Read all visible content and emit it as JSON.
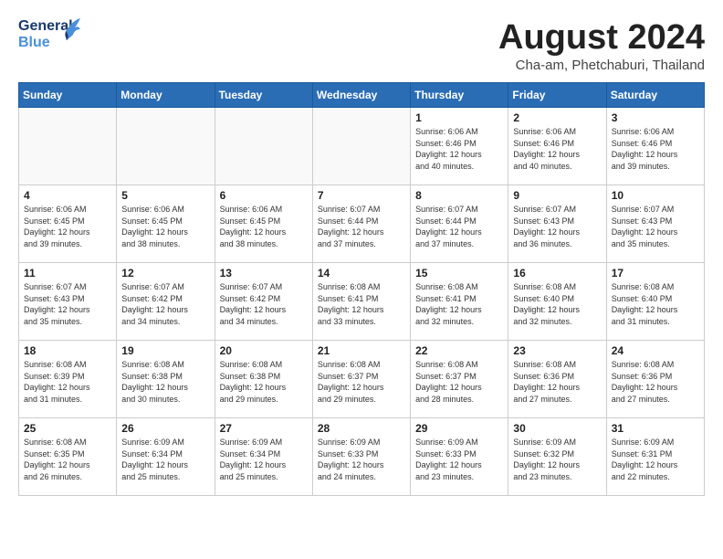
{
  "logo": {
    "general": "General",
    "blue": "Blue"
  },
  "title": "August 2024",
  "subtitle": "Cha-am, Phetchaburi, Thailand",
  "days_of_week": [
    "Sunday",
    "Monday",
    "Tuesday",
    "Wednesday",
    "Thursday",
    "Friday",
    "Saturday"
  ],
  "weeks": [
    [
      {
        "day": "",
        "info": ""
      },
      {
        "day": "",
        "info": ""
      },
      {
        "day": "",
        "info": ""
      },
      {
        "day": "",
        "info": ""
      },
      {
        "day": "1",
        "info": "Sunrise: 6:06 AM\nSunset: 6:46 PM\nDaylight: 12 hours\nand 40 minutes."
      },
      {
        "day": "2",
        "info": "Sunrise: 6:06 AM\nSunset: 6:46 PM\nDaylight: 12 hours\nand 40 minutes."
      },
      {
        "day": "3",
        "info": "Sunrise: 6:06 AM\nSunset: 6:46 PM\nDaylight: 12 hours\nand 39 minutes."
      }
    ],
    [
      {
        "day": "4",
        "info": "Sunrise: 6:06 AM\nSunset: 6:45 PM\nDaylight: 12 hours\nand 39 minutes."
      },
      {
        "day": "5",
        "info": "Sunrise: 6:06 AM\nSunset: 6:45 PM\nDaylight: 12 hours\nand 38 minutes."
      },
      {
        "day": "6",
        "info": "Sunrise: 6:06 AM\nSunset: 6:45 PM\nDaylight: 12 hours\nand 38 minutes."
      },
      {
        "day": "7",
        "info": "Sunrise: 6:07 AM\nSunset: 6:44 PM\nDaylight: 12 hours\nand 37 minutes."
      },
      {
        "day": "8",
        "info": "Sunrise: 6:07 AM\nSunset: 6:44 PM\nDaylight: 12 hours\nand 37 minutes."
      },
      {
        "day": "9",
        "info": "Sunrise: 6:07 AM\nSunset: 6:43 PM\nDaylight: 12 hours\nand 36 minutes."
      },
      {
        "day": "10",
        "info": "Sunrise: 6:07 AM\nSunset: 6:43 PM\nDaylight: 12 hours\nand 35 minutes."
      }
    ],
    [
      {
        "day": "11",
        "info": "Sunrise: 6:07 AM\nSunset: 6:43 PM\nDaylight: 12 hours\nand 35 minutes."
      },
      {
        "day": "12",
        "info": "Sunrise: 6:07 AM\nSunset: 6:42 PM\nDaylight: 12 hours\nand 34 minutes."
      },
      {
        "day": "13",
        "info": "Sunrise: 6:07 AM\nSunset: 6:42 PM\nDaylight: 12 hours\nand 34 minutes."
      },
      {
        "day": "14",
        "info": "Sunrise: 6:08 AM\nSunset: 6:41 PM\nDaylight: 12 hours\nand 33 minutes."
      },
      {
        "day": "15",
        "info": "Sunrise: 6:08 AM\nSunset: 6:41 PM\nDaylight: 12 hours\nand 32 minutes."
      },
      {
        "day": "16",
        "info": "Sunrise: 6:08 AM\nSunset: 6:40 PM\nDaylight: 12 hours\nand 32 minutes."
      },
      {
        "day": "17",
        "info": "Sunrise: 6:08 AM\nSunset: 6:40 PM\nDaylight: 12 hours\nand 31 minutes."
      }
    ],
    [
      {
        "day": "18",
        "info": "Sunrise: 6:08 AM\nSunset: 6:39 PM\nDaylight: 12 hours\nand 31 minutes."
      },
      {
        "day": "19",
        "info": "Sunrise: 6:08 AM\nSunset: 6:38 PM\nDaylight: 12 hours\nand 30 minutes."
      },
      {
        "day": "20",
        "info": "Sunrise: 6:08 AM\nSunset: 6:38 PM\nDaylight: 12 hours\nand 29 minutes."
      },
      {
        "day": "21",
        "info": "Sunrise: 6:08 AM\nSunset: 6:37 PM\nDaylight: 12 hours\nand 29 minutes."
      },
      {
        "day": "22",
        "info": "Sunrise: 6:08 AM\nSunset: 6:37 PM\nDaylight: 12 hours\nand 28 minutes."
      },
      {
        "day": "23",
        "info": "Sunrise: 6:08 AM\nSunset: 6:36 PM\nDaylight: 12 hours\nand 27 minutes."
      },
      {
        "day": "24",
        "info": "Sunrise: 6:08 AM\nSunset: 6:36 PM\nDaylight: 12 hours\nand 27 minutes."
      }
    ],
    [
      {
        "day": "25",
        "info": "Sunrise: 6:08 AM\nSunset: 6:35 PM\nDaylight: 12 hours\nand 26 minutes."
      },
      {
        "day": "26",
        "info": "Sunrise: 6:09 AM\nSunset: 6:34 PM\nDaylight: 12 hours\nand 25 minutes."
      },
      {
        "day": "27",
        "info": "Sunrise: 6:09 AM\nSunset: 6:34 PM\nDaylight: 12 hours\nand 25 minutes."
      },
      {
        "day": "28",
        "info": "Sunrise: 6:09 AM\nSunset: 6:33 PM\nDaylight: 12 hours\nand 24 minutes."
      },
      {
        "day": "29",
        "info": "Sunrise: 6:09 AM\nSunset: 6:33 PM\nDaylight: 12 hours\nand 23 minutes."
      },
      {
        "day": "30",
        "info": "Sunrise: 6:09 AM\nSunset: 6:32 PM\nDaylight: 12 hours\nand 23 minutes."
      },
      {
        "day": "31",
        "info": "Sunrise: 6:09 AM\nSunset: 6:31 PM\nDaylight: 12 hours\nand 22 minutes."
      }
    ]
  ]
}
